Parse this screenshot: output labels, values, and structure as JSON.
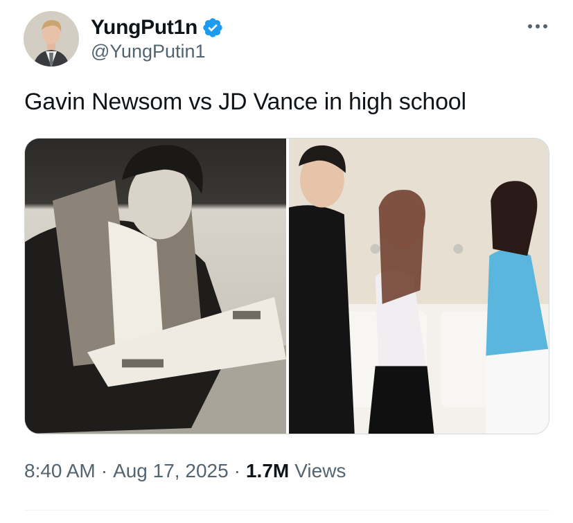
{
  "author": {
    "display_name": "YungPut1n",
    "handle": "@YungPutin1",
    "verified": true,
    "verified_color": "#1d9bf0"
  },
  "tweet": {
    "text": "Gavin Newsom vs JD Vance in high school"
  },
  "media": {
    "count": 2
  },
  "meta": {
    "time": "8:40 AM",
    "date": "Aug 17, 2025",
    "views_count": "1.7M",
    "views_label": "Views",
    "separator": "·"
  },
  "icons": {
    "more": "more-horizontal-icon",
    "verified": "verified-badge-icon"
  }
}
